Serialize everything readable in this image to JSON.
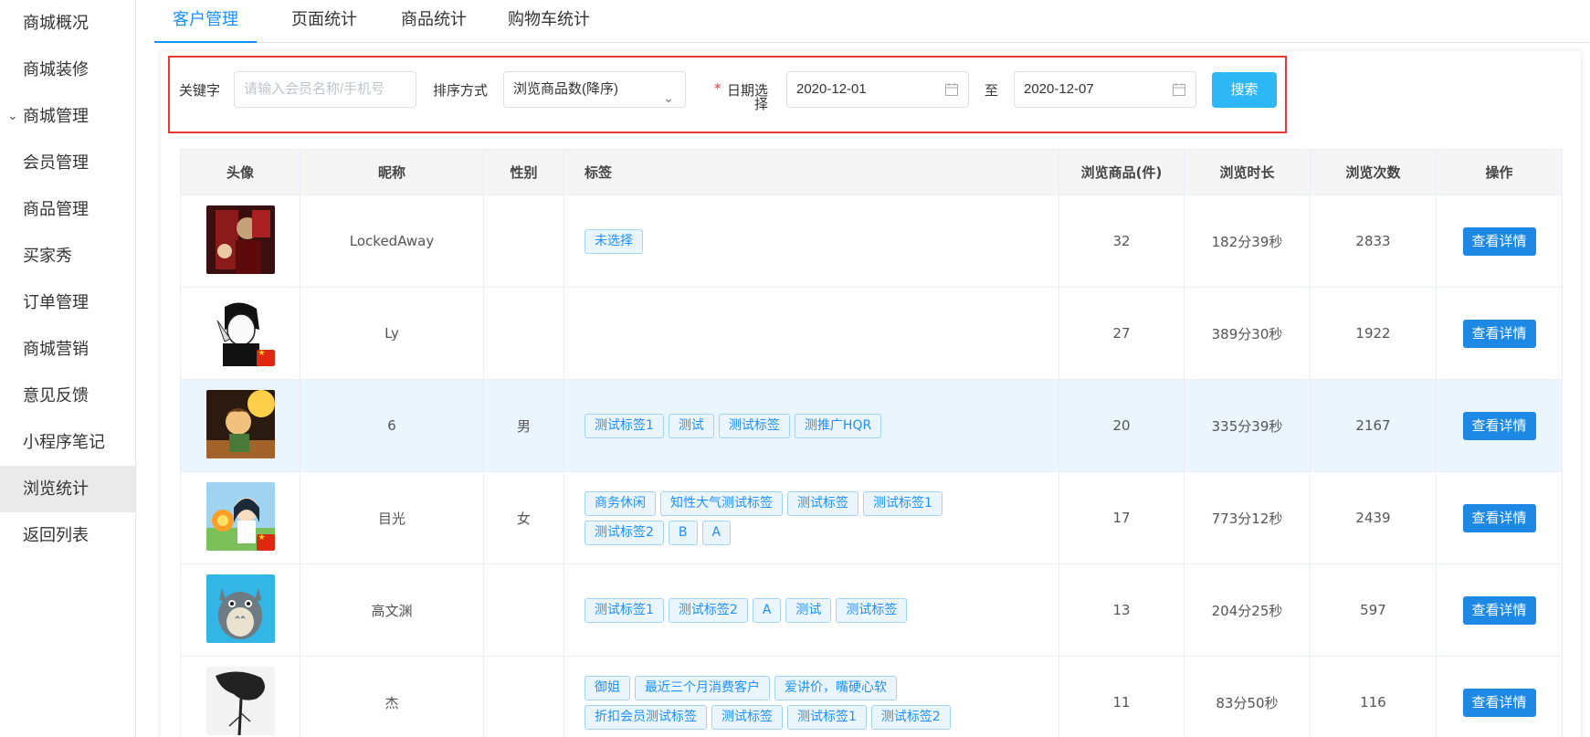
{
  "sidebar": {
    "items": [
      {
        "label": "商城概况"
      },
      {
        "label": "商城装修"
      },
      {
        "label": "商城管理"
      },
      {
        "label": "会员管理"
      },
      {
        "label": "商品管理"
      },
      {
        "label": "买家秀"
      },
      {
        "label": "订单管理"
      },
      {
        "label": "商城营销"
      },
      {
        "label": "意见反馈"
      },
      {
        "label": "小程序笔记"
      },
      {
        "label": "浏览统计"
      },
      {
        "label": "返回列表"
      }
    ],
    "active": "浏览统计"
  },
  "tabs": [
    {
      "label": "客户管理",
      "active": true
    },
    {
      "label": "页面统计"
    },
    {
      "label": "商品统计"
    },
    {
      "label": "购物车统计"
    }
  ],
  "filter": {
    "keyword_label": "关键字",
    "keyword_placeholder": "请输入会员名称/手机号",
    "sort_label": "排序方式",
    "sort_value": "浏览商品数(降序)",
    "date_label_line1": "日期选",
    "date_label_line2": "择",
    "date_required_mark": "*",
    "date_start": "2020-12-01",
    "date_sep": "至",
    "date_end": "2020-12-07",
    "search_label": "搜索"
  },
  "table": {
    "headers": [
      "头像",
      "昵称",
      "性别",
      "标签",
      "浏览商品(件)",
      "浏览时长",
      "浏览次数",
      "操作"
    ],
    "action_label": "查看详情",
    "rows": [
      {
        "nickname": "LockedAway",
        "gender": "",
        "tags": [
          "未选择"
        ],
        "goods": "32",
        "duration": "182分39秒",
        "visits": "2833",
        "avatar": "dark-red-photo"
      },
      {
        "nickname": "Ly",
        "gender": "",
        "tags": [],
        "goods": "27",
        "duration": "389分30秒",
        "visits": "1922",
        "avatar": "manga-sketch"
      },
      {
        "nickname": "6",
        "gender": "男",
        "tags": [
          "测试标签1",
          "测试",
          "测试标签",
          "测推广HQR"
        ],
        "goods": "20",
        "duration": "335分39秒",
        "visits": "2167",
        "avatar": "anime-orange"
      },
      {
        "nickname": "目光",
        "gender": "女",
        "tags": [
          "商务休闲",
          "知性大气测试标签",
          "测试标签",
          "测试标签1",
          "测试标签2",
          "B",
          "A"
        ],
        "goods": "17",
        "duration": "773分12秒",
        "visits": "2439",
        "avatar": "anime-girl"
      },
      {
        "nickname": "高文渊",
        "gender": "",
        "tags": [
          "测试标签1",
          "测试标签2",
          "A",
          "测试",
          "测试标签"
        ],
        "goods": "13",
        "duration": "204分25秒",
        "visits": "597",
        "avatar": "totoro"
      },
      {
        "nickname": "杰",
        "gender": "",
        "tags": [
          "御姐",
          "最近三个月消费客户",
          "爱讲价，嘴硬心软",
          "折扣会员测试标签",
          "测试标签",
          "测试标签1",
          "测试标签2"
        ],
        "goods": "11",
        "duration": "83分50秒",
        "visits": "116",
        "avatar": "ink-tree"
      }
    ]
  },
  "colors": {
    "accent": "#1890ff",
    "search_btn": "#2db7f5",
    "detail_btn": "#1e88e5",
    "highlight_row": "#eaf5fd",
    "filter_border": "#e53935"
  }
}
